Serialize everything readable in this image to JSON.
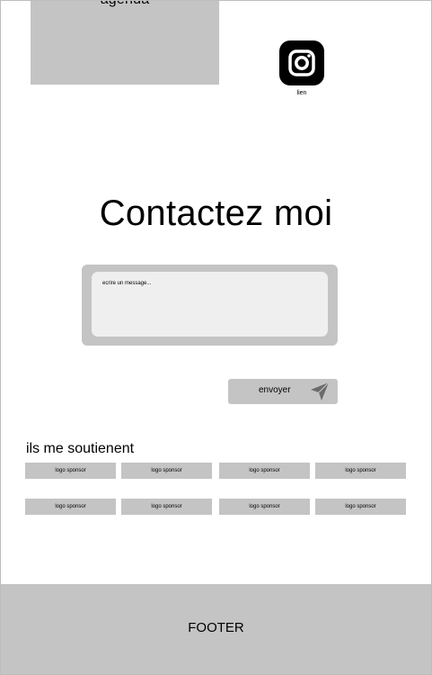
{
  "agenda": {
    "label": "agenda"
  },
  "social": {
    "icon": "instagram-icon",
    "link_label": "lien"
  },
  "contact": {
    "title": "Contactez moi",
    "message_placeholder": "ecrire un message...",
    "send_label": "envoyer",
    "send_icon": "paper-plane-icon"
  },
  "sponsors": {
    "title": "ils me soutienent",
    "items": [
      "logo sponsor",
      "logo sponsor",
      "logo sponsor",
      "logo sponsor",
      "logo sponsor",
      "logo sponsor",
      "logo sponsor",
      "logo sponsor"
    ]
  },
  "footer": {
    "label": "FOOTER"
  }
}
